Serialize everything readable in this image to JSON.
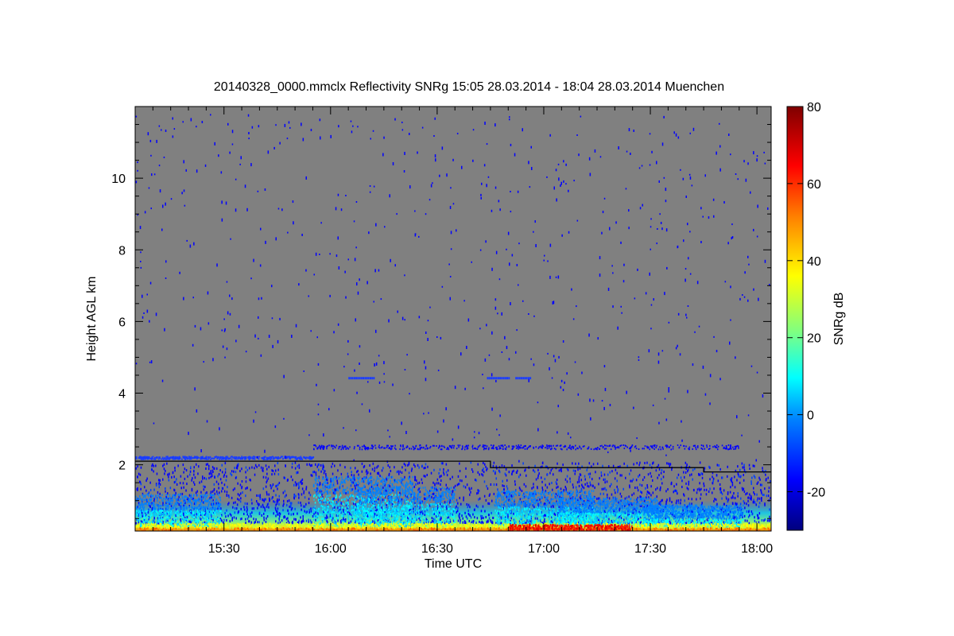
{
  "chart_data": {
    "type": "heatmap",
    "title": "20140328_0000.mmclx Reflectivity SNRg   15:05 28.03.2014 - 18:04 28.03.2014 Muenchen",
    "xlabel": "Time UTC",
    "ylabel": "Height AGL km",
    "xlim": [
      "15:05",
      "18:04"
    ],
    "ylim": [
      0.15,
      12.0
    ],
    "x_ticks": [
      "15:30",
      "16:00",
      "16:30",
      "17:00",
      "17:30",
      "18:00"
    ],
    "y_ticks": [
      2,
      4,
      6,
      8,
      10
    ],
    "colorbar": {
      "label": "SNRg dB",
      "range": [
        -30,
        80
      ],
      "ticks": [
        -20,
        0,
        20,
        40,
        60,
        80
      ],
      "colors": [
        "#00007f",
        "#0000ff",
        "#0080ff",
        "#00ffff",
        "#80ff80",
        "#ffff00",
        "#ff8000",
        "#ff0000",
        "#7f0000"
      ]
    },
    "background_color": "#808080",
    "boundary_line": [
      {
        "time": "15:05",
        "height": 2.1
      },
      {
        "time": "16:45",
        "height": 2.1
      },
      {
        "time": "16:45",
        "height": 1.92
      },
      {
        "time": "17:45",
        "height": 1.92
      },
      {
        "time": "17:45",
        "height": 1.8
      },
      {
        "time": "18:04",
        "height": 1.8
      }
    ]
  }
}
